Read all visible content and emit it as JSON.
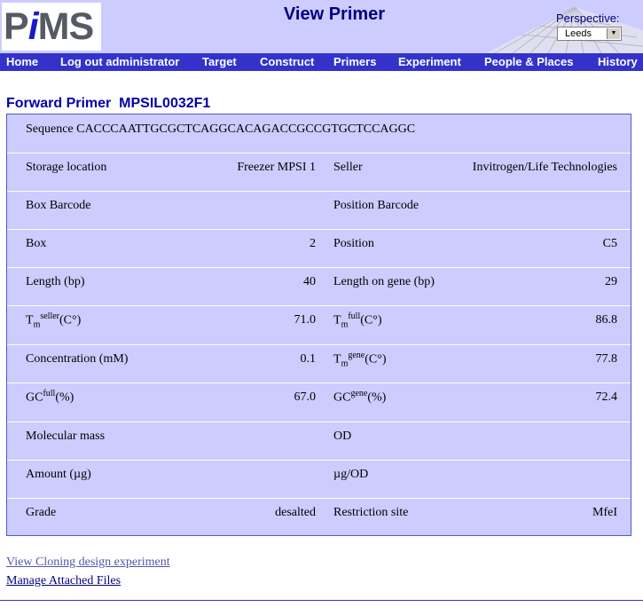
{
  "header": {
    "logo_text": "PiMS",
    "page_heading": "View Primer",
    "perspective_label": "Perspective:",
    "perspective_value": "Leeds"
  },
  "nav": [
    "Home",
    "Log out administrator",
    "Target",
    "Construct",
    "Primers",
    "Experiment",
    "People & Places",
    "History"
  ],
  "primer": {
    "title": "Forward Primer  MPSIL0032F1",
    "sequence_label": "Sequence",
    "sequence_value": "CACCCAATTGCGCTCAGGCACAGACCGCCGTGCTCCAGGC",
    "rows": [
      {
        "l1": "Storage location",
        "v1": "Freezer MPSI 1",
        "l2": "Seller",
        "v2": "Invitrogen/Life Technologies"
      },
      {
        "l1": "Box Barcode",
        "v1": "",
        "l2": "Position Barcode",
        "v2": ""
      },
      {
        "l1": "Box",
        "v1": "2",
        "l2": "Position",
        "v2": "C5"
      },
      {
        "l1": "Length (bp)",
        "v1": "40",
        "l2": "Length on gene (bp)",
        "v2": "29"
      },
      {
        "l1_base": "T",
        "l1_sub": "m",
        "l1_sup": "seller",
        "l1_unit": "(C°)",
        "v1": "71.0",
        "l2_base": "T",
        "l2_sub": "m",
        "l2_sup": "full",
        "l2_unit": "(C°)",
        "v2": "86.8"
      },
      {
        "l1": "Concentration (mM)",
        "v1": "0.1",
        "l2_base": "T",
        "l2_sub": "m",
        "l2_sup": "gene",
        "l2_unit": "(C°)",
        "v2": "77.8"
      },
      {
        "l1_base": "GC",
        "l1_sup": "full",
        "l1_unit": "(%)",
        "v1": "67.0",
        "l2_base": "GC",
        "l2_sup": "gene",
        "l2_unit": "(%)",
        "v2": "72.4"
      },
      {
        "l1": "Molecular mass",
        "v1": "",
        "l2": "OD",
        "v2": ""
      },
      {
        "l1": "Amount (µg)",
        "v1": "",
        "l2": "µg/OD",
        "v2": ""
      },
      {
        "l1": "Grade",
        "v1": "desalted",
        "l2": "Restriction site",
        "v2": "MfeI"
      }
    ]
  },
  "links": {
    "cloning": "View Cloning design experiment",
    "files": "Manage Attached Files"
  },
  "colors": {
    "header_bg": "#ccccff",
    "nav_bg": "#3333cc",
    "panel_bg": "#ccccff",
    "title": "#0000aa",
    "visited_link": "#5555aa",
    "link": "#000080"
  }
}
